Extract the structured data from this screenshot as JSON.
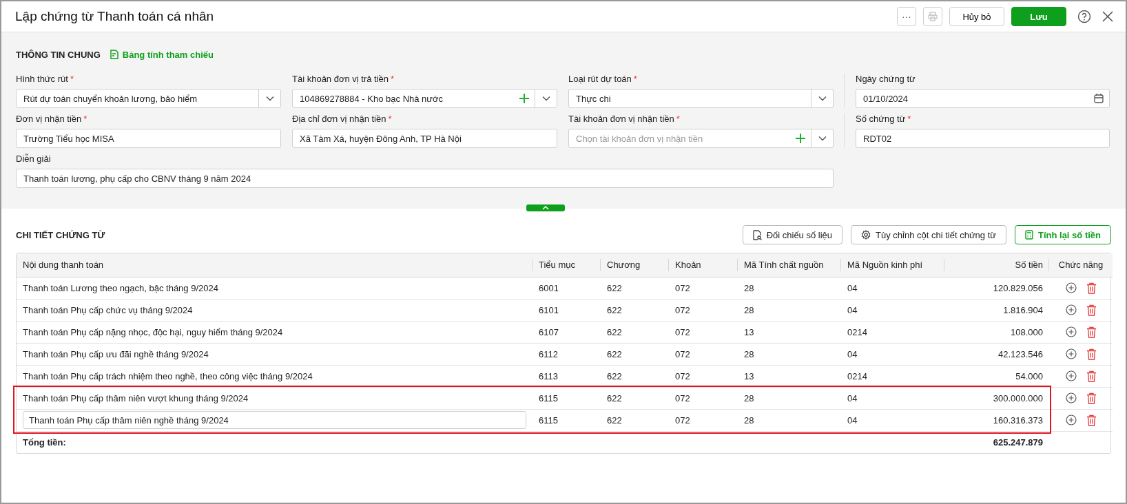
{
  "window": {
    "title": "Lập chứng từ Thanh toán cá nhân",
    "buttons": [
      {
        "kind": "more",
        "label": "···"
      },
      {
        "kind": "print",
        "disabled": true
      },
      {
        "kind": "cancel",
        "label": "Hủy bỏ"
      },
      {
        "kind": "save",
        "label": "Lưu"
      },
      {
        "kind": "help"
      },
      {
        "kind": "close"
      }
    ]
  },
  "general": {
    "heading": "THÔNG TIN CHUNG",
    "link": "Bảng tính tham chiếu",
    "fields": [
      {
        "label": "Hình thức rút",
        "required_mark": "*",
        "value": "Rút dự toán chuyển khoản lương, bảo hiểm",
        "kind": "select",
        "add": false
      },
      {
        "label": "Tài khoản đơn vị trả tiền",
        "required_mark": "*",
        "value": "104869278884 - Kho bạc Nhà nước",
        "kind": "select",
        "add": true
      },
      {
        "label": "Loại rút dự toán",
        "required_mark": "*",
        "value": "Thực chi",
        "kind": "select",
        "add": false
      },
      {
        "label": "Ngày chứng từ",
        "value": "01/10/2024",
        "kind": "date"
      },
      {
        "label": "Đơn vị nhận tiền",
        "required_mark": "*",
        "value": "Trường Tiểu học MISA",
        "kind": "text"
      },
      {
        "label": "Địa chỉ đơn vị nhận tiền",
        "required_mark": "*",
        "value": "Xã Tàm Xá, huyện Đông Anh, TP Hà Nội",
        "kind": "text"
      },
      {
        "label": "Tài khoản đơn vị nhận tiền",
        "required_mark": "*",
        "placeholder": "Chọn tài khoản đơn vị nhận tiền",
        "kind": "select",
        "add": true
      },
      {
        "label": "Số chứng từ",
        "required_mark": "*",
        "value": "RDT02",
        "kind": "text"
      },
      {
        "label": "Diễn giải",
        "value": "Thanh toán lương, phụ cấp cho CBNV tháng 9 năm 2024",
        "kind": "text"
      }
    ]
  },
  "detail": {
    "heading": "CHI TIẾT CHỨNG TỪ",
    "actions": [
      {
        "kind": "compare",
        "label": "Đối chiếu số liệu"
      },
      {
        "kind": "columns",
        "label": "Tùy chỉnh cột chi tiết chứng từ"
      },
      {
        "kind": "recalc",
        "label": "Tính lại số tiền"
      }
    ],
    "table": {
      "columns": [
        "Nội dung thanh toán",
        "Tiểu mục",
        "Chương",
        "Khoản",
        "Mã Tính chất nguồn",
        "Mã Nguồn kinh phí",
        "Số tiền",
        "Chức năng"
      ],
      "rows": [
        {
          "cells": [
            "Thanh toán Lương theo ngạch, bậc tháng 9/2024",
            "6001",
            "622",
            "072",
            "28",
            "04",
            "120.829.056"
          ],
          "editing": false,
          "highlighted": false
        },
        {
          "cells": [
            "Thanh toán Phụ cấp chức vụ tháng 9/2024",
            "6101",
            "622",
            "072",
            "28",
            "04",
            "1.816.904"
          ],
          "editing": false,
          "highlighted": false
        },
        {
          "cells": [
            "Thanh toán Phụ cấp nặng nhọc, độc hại, nguy hiểm tháng 9/2024",
            "6107",
            "622",
            "072",
            "13",
            "0214",
            "108.000"
          ],
          "editing": false,
          "highlighted": false
        },
        {
          "cells": [
            "Thanh toán Phụ cấp ưu đãi nghề tháng 9/2024",
            "6112",
            "622",
            "072",
            "28",
            "04",
            "42.123.546"
          ],
          "editing": false,
          "highlighted": false
        },
        {
          "cells": [
            "Thanh toán Phụ cấp trách nhiệm theo nghề, theo công việc tháng 9/2024",
            "6113",
            "622",
            "072",
            "13",
            "0214",
            "54.000"
          ],
          "editing": false,
          "highlighted": false
        },
        {
          "cells": [
            "Thanh toán Phụ cấp thâm niên vượt khung tháng 9/2024",
            "6115",
            "622",
            "072",
            "28",
            "04",
            "300.000.000"
          ],
          "editing": false,
          "highlighted": true
        },
        {
          "cells": [
            "Thanh toán Phụ cấp thâm niên nghề tháng 9/2024",
            "6115",
            "622",
            "072",
            "28",
            "04",
            "160.316.373"
          ],
          "editing": true,
          "highlighted": true
        }
      ],
      "total_label": "Tổng tiền:",
      "total": "625.247.879"
    }
  }
}
